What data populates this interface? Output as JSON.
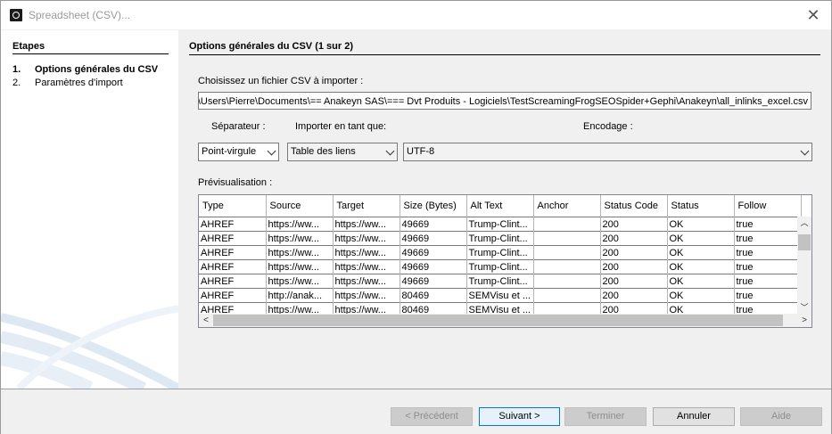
{
  "window": {
    "title": "Spreadsheet (CSV)...",
    "app_icon": "gephi-logo-icon",
    "close_icon": "close-icon"
  },
  "sidebar": {
    "heading": "Etapes",
    "steps": [
      {
        "num": "1.",
        "label": "Options générales du CSV"
      },
      {
        "num": "2.",
        "label": "Paramètres d'import"
      }
    ]
  },
  "main": {
    "heading": "Options générales du CSV (1 sur 2)",
    "file_label": "Choisissez un fichier CSV à importer :",
    "file_path": "C:\\Users\\Pierre\\Documents\\== Anakeyn SAS\\=== Dvt Produits - Logiciels\\TestScreamingFrogSEOSpider+Gephi\\Anakeyn\\all_inlinks_excel.csv",
    "separator_label": "Séparateur :",
    "separator_value": "Point-virgule",
    "import_as_label": "Importer en tant que:",
    "import_as_value": "Table des liens",
    "encoding_label": "Encodage :",
    "encoding_value": "UTF-8",
    "preview_label": "Prévisualisation :"
  },
  "preview": {
    "columns": [
      "Type",
      "Source",
      "Target",
      "Size (Bytes)",
      "Alt Text",
      "Anchor",
      "Status Code",
      "Status",
      "Follow"
    ],
    "rows": [
      [
        "AHREF",
        "https://ww...",
        "https://ww...",
        "49669",
        "Trump-Clint...",
        "",
        "200",
        "OK",
        "true"
      ],
      [
        "AHREF",
        "https://ww...",
        "https://ww...",
        "49669",
        "Trump-Clint...",
        "",
        "200",
        "OK",
        "true"
      ],
      [
        "AHREF",
        "https://ww...",
        "https://ww...",
        "49669",
        "Trump-Clint...",
        "",
        "200",
        "OK",
        "true"
      ],
      [
        "AHREF",
        "https://ww...",
        "https://ww...",
        "49669",
        "Trump-Clint...",
        "",
        "200",
        "OK",
        "true"
      ],
      [
        "AHREF",
        "https://ww...",
        "https://ww...",
        "49669",
        "Trump-Clint...",
        "",
        "200",
        "OK",
        "true"
      ],
      [
        "AHREF",
        "http://anak...",
        "https://ww...",
        "80469",
        "SEMVisu et ...",
        "",
        "200",
        "OK",
        "true"
      ],
      [
        "AHREF",
        "https://ww...",
        "https://ww...",
        "80469",
        "SEMVisu et ...",
        "",
        "200",
        "OK",
        "true"
      ]
    ]
  },
  "buttons": {
    "previous": "< Précédent",
    "next": "Suivant >",
    "finish": "Terminer",
    "cancel": "Annuler",
    "help": "Aide"
  }
}
